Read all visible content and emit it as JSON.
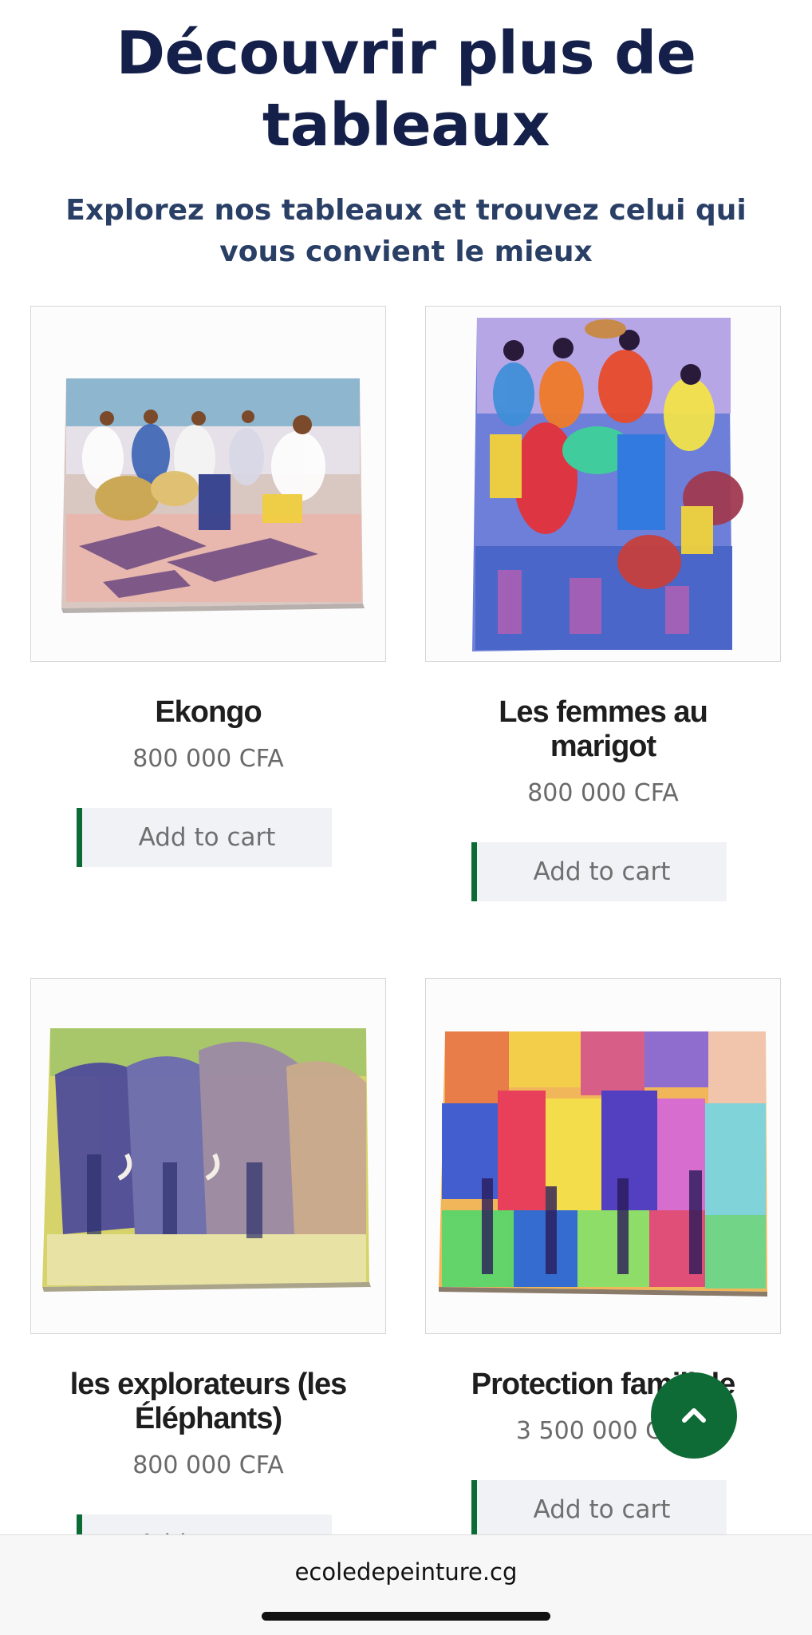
{
  "section": {
    "title": "Découvrir plus de tableaux",
    "subtitle": "Explorez nos tableaux et trouvez celui qui vous convient le mieux"
  },
  "products": [
    {
      "name": "Ekongo",
      "price": "800 000 CFA",
      "button_label": "Add to cart"
    },
    {
      "name": "Les femmes au marigot",
      "price": "800 000 CFA",
      "button_label": "Add to cart"
    },
    {
      "name": "les explorateurs (les Éléphants)",
      "price": "800 000 CFA",
      "button_label": "Add to cart"
    },
    {
      "name": "Protection familiale",
      "price": "3 500 000 CFA",
      "button_label": "Add to cart"
    }
  ],
  "scroll_top": {
    "icon": "chevron-up-icon"
  },
  "browser": {
    "url": "ecoledepeinture.cg"
  },
  "colors": {
    "heading": "#14204a",
    "subheading": "#2a3f66",
    "accent_green": "#0f6b35",
    "button_bg": "#f1f2f5",
    "price_text": "#6a6a6a"
  }
}
